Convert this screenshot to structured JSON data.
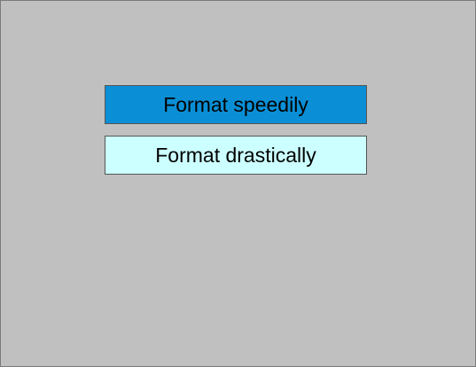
{
  "menu": {
    "options": [
      {
        "label": "Format speedily",
        "selected": true
      },
      {
        "label": "Format drastically",
        "selected": false
      }
    ]
  },
  "colors": {
    "background": "#c0c0c0",
    "selected_fill": "#0a8fd6",
    "unselected_fill": "#ccffff"
  }
}
